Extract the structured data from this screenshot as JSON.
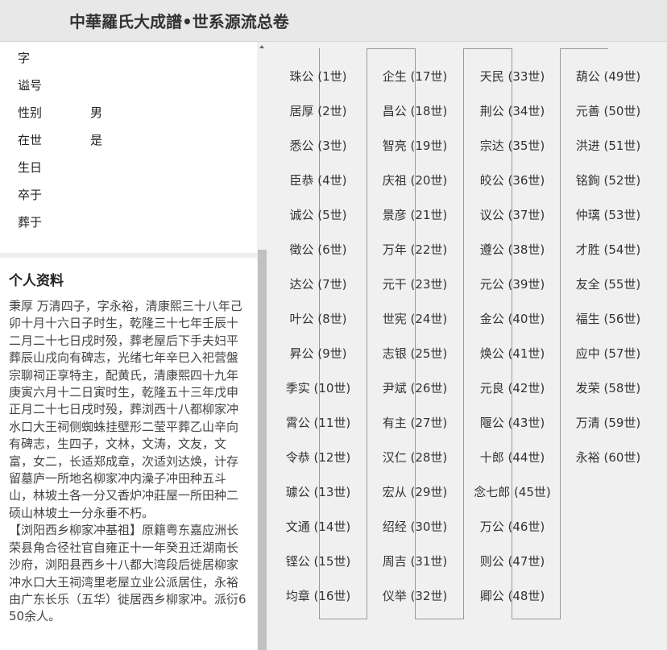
{
  "header": {
    "title": "中華羅氏大成譜•世系源流总卷"
  },
  "fields": [
    {
      "label": "字",
      "value": ""
    },
    {
      "label": "谥号",
      "value": ""
    },
    {
      "label": "性别",
      "value": "男"
    },
    {
      "label": "在世",
      "value": "是"
    },
    {
      "label": "生日",
      "value": ""
    },
    {
      "label": "卒于",
      "value": ""
    },
    {
      "label": "葬于",
      "value": ""
    }
  ],
  "profile": {
    "heading": "个人资料",
    "paragraph1": "秉厚 万清四子，字永裕，清康熙三十八年己卯十月十六日子时生，乾隆三十七年壬辰十二月二十七日戌时殁，葬老屋后下手夫妇平葬辰山戌向有碑志，光绪七年辛巳入祀营盤宗聊祠正享特主，配黄氏，清康熙四十九年庚寅六月十二日寅时生，乾隆五十三年戊申正月二十七日戌时殁，葬浏西十八都柳家冲水口大王祠侧蜘蛛挂壁形二莹平葬乙山辛向有碑志，生四子，文林，文涛，文友，文富，女二，长适郑成章，次适刘达焕，计存留墓庐一所地名柳家冲内澡子冲田种五斗山，林坡土各一分又香炉冲莊屋一所田种二硕山林坡土一分永垂不朽。",
    "paragraph2": "【浏阳西乡柳家冲基祖】原籍粤东嘉应洲长荣县角合径社官自雍正十一年癸丑迁湖南长沙府，浏阳县西乡十八都大湾段后徙居柳家冲水口大王祠湾里老屋立业公派居住，永裕由广东长乐（五华）徙居西乡柳家冲。派衍650余人。"
  },
  "generations": [
    [
      "珠公 (1世)",
      "居厚 (2世)",
      "悉公 (3世)",
      "臣恭 (4世)",
      "诚公 (5世)",
      "徵公 (6世)",
      "达公 (7世)",
      "叶公 (8世)",
      "昇公 (9世)",
      "季实 (10世)",
      "霄公 (11世)",
      "令恭 (12世)",
      "璩公 (13世)",
      "文通 (14世)",
      "铿公 (15世)",
      "均章 (16世)"
    ],
    [
      "企生 (17世)",
      "昌公 (18世)",
      "智亮 (19世)",
      "庆祖 (20世)",
      "景彦 (21世)",
      "万年 (22世)",
      "元干 (23世)",
      "世宪 (24世)",
      "志银 (25世)",
      "尹斌 (26世)",
      "有主 (27世)",
      "汉仁 (28世)",
      "宏从 (29世)",
      "绍经 (30世)",
      "周吉 (31世)",
      "仪举 (32世)"
    ],
    [
      "天民 (33世)",
      "荆公 (34世)",
      "宗达 (35世)",
      "皎公 (36世)",
      "议公 (37世)",
      "遵公 (38世)",
      "元公 (39世)",
      "金公 (40世)",
      "焕公 (41世)",
      "元良 (42世)",
      "隁公 (43世)",
      "十郎 (44世)",
      "念七郎 (45世)",
      "万公 (46世)",
      "则公 (47世)",
      "卿公 (48世)"
    ],
    [
      "葫公 (49世)",
      "元善 (50世)",
      "洪进 (51世)",
      "铭銁 (52世)",
      "仲璃 (53世)",
      "才胜 (54世)",
      "友全 (55世)",
      "福生 (56世)",
      "应中 (57世)",
      "发荣 (58世)",
      "万清 (59世)",
      "永裕 (60世)"
    ]
  ]
}
